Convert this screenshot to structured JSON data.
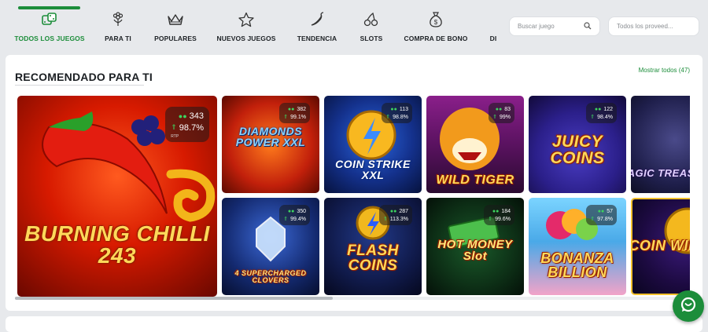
{
  "nav": {
    "items": [
      {
        "label": "TODOS LOS JUEGOS",
        "icon": "dice-icon",
        "active": true
      },
      {
        "label": "PARA TI",
        "icon": "flower-icon",
        "active": false
      },
      {
        "label": "POPULARES",
        "icon": "crown-icon",
        "active": false
      },
      {
        "label": "NUEVOS JUEGOS",
        "icon": "star-icon",
        "active": false
      },
      {
        "label": "TENDENCIA",
        "icon": "chili-icon",
        "active": false
      },
      {
        "label": "SLOTS",
        "icon": "cherry-icon",
        "active": false
      },
      {
        "label": "COMPRA DE BONO",
        "icon": "money-bag-icon",
        "active": false
      },
      {
        "label": "DI",
        "icon": "",
        "active": false
      }
    ],
    "search_game_placeholder": "Buscar juego",
    "search_provider_placeholder": "Todos los proveed..."
  },
  "section": {
    "title": "RECOMENDADO PARA TI",
    "show_all": "Mostrar todos",
    "count": "(47)"
  },
  "games": [
    {
      "name": "BURNING CHILLI 243",
      "players": "343",
      "rtp": "98.7%",
      "rtp_tag": "RTP"
    },
    {
      "name": "DIAMONDS POWER XXL",
      "players": "382",
      "rtp": "99.1%"
    },
    {
      "name": "COIN STRIKE XXL",
      "players": "113",
      "rtp": "98.8%"
    },
    {
      "name": "WILD TIGER",
      "players": "83",
      "rtp": "99%"
    },
    {
      "name": "JUICY COINS",
      "players": "122",
      "rtp": "98.4%"
    },
    {
      "name": "MAGIC TREASURE",
      "players": "",
      "rtp": ""
    },
    {
      "name": "4 SUPERCHARGED CLOVERS",
      "players": "350",
      "rtp": "99.4%"
    },
    {
      "name": "FLASH COINS",
      "players": "287",
      "rtp": "113.3%"
    },
    {
      "name": "HOT MONEY Slot",
      "players": "184",
      "rtp": "99.6%"
    },
    {
      "name": "BONANZA BILLION",
      "players": "57",
      "rtp": "97.8%"
    },
    {
      "name": "COIN WIN",
      "players": "",
      "rtp": ""
    }
  ],
  "colors": {
    "accent": "#1c8d3a",
    "background": "#e7e9ec"
  }
}
